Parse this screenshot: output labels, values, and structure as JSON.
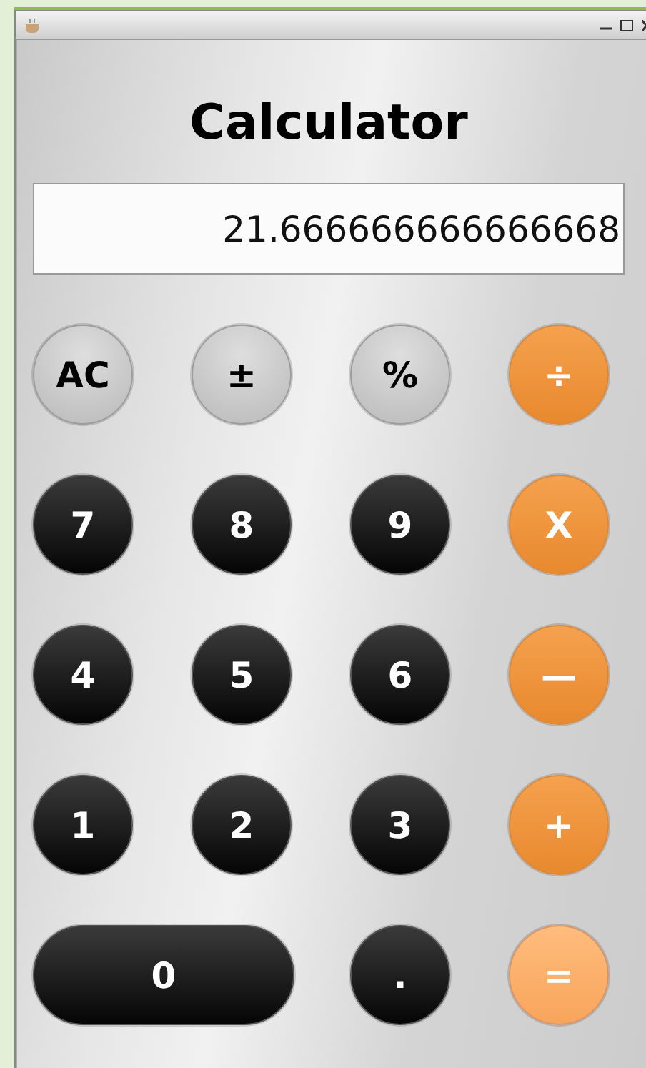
{
  "window": {
    "title": "Calculator"
  },
  "display": {
    "value": "21.666666666666668"
  },
  "buttons": [
    {
      "label": "AC",
      "kind": "function",
      "wide": false
    },
    {
      "label": "±",
      "kind": "function",
      "wide": false
    },
    {
      "label": "%",
      "kind": "function",
      "wide": false
    },
    {
      "label": "÷",
      "kind": "operator",
      "wide": false
    },
    {
      "label": "7",
      "kind": "digit",
      "wide": false
    },
    {
      "label": "8",
      "kind": "digit",
      "wide": false
    },
    {
      "label": "9",
      "kind": "digit",
      "wide": false
    },
    {
      "label": "X",
      "kind": "operator",
      "wide": false
    },
    {
      "label": "4",
      "kind": "digit",
      "wide": false
    },
    {
      "label": "5",
      "kind": "digit",
      "wide": false
    },
    {
      "label": "6",
      "kind": "digit",
      "wide": false
    },
    {
      "label": "—",
      "kind": "operator",
      "wide": false
    },
    {
      "label": "1",
      "kind": "digit",
      "wide": false
    },
    {
      "label": "2",
      "kind": "digit",
      "wide": false
    },
    {
      "label": "3",
      "kind": "digit",
      "wide": false
    },
    {
      "label": "+",
      "kind": "operator",
      "wide": false
    },
    {
      "label": "0",
      "kind": "digit",
      "wide": true
    },
    {
      "label": ".",
      "kind": "digit",
      "wide": false
    },
    {
      "label": "=",
      "kind": "equals",
      "wide": false
    }
  ]
}
